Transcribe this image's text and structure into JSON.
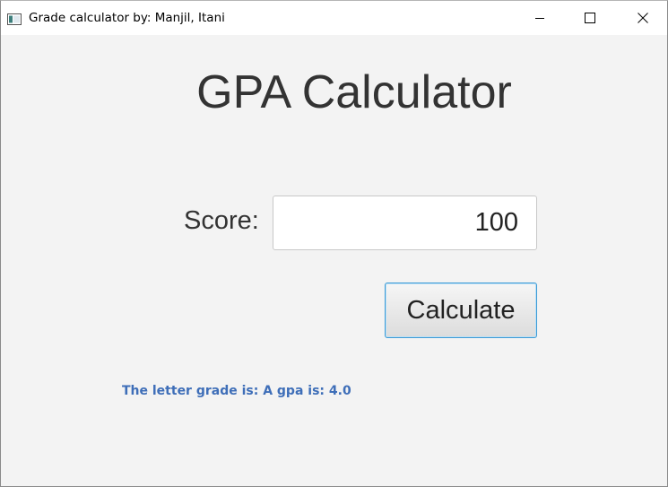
{
  "window": {
    "title": "Grade calculator by: Manjil, Itani"
  },
  "main": {
    "heading": "GPA Calculator",
    "score_label": "Score:",
    "score_value": "100",
    "calculate_label": "Calculate",
    "result": "The letter grade is: A gpa is: 4.0"
  },
  "colors": {
    "result_text": "#3e6eb8",
    "button_focus_border": "#3c9bd6"
  },
  "icons": {
    "app": "java-app-icon",
    "minimize": "minimize-icon",
    "maximize": "maximize-icon",
    "close": "close-icon"
  }
}
